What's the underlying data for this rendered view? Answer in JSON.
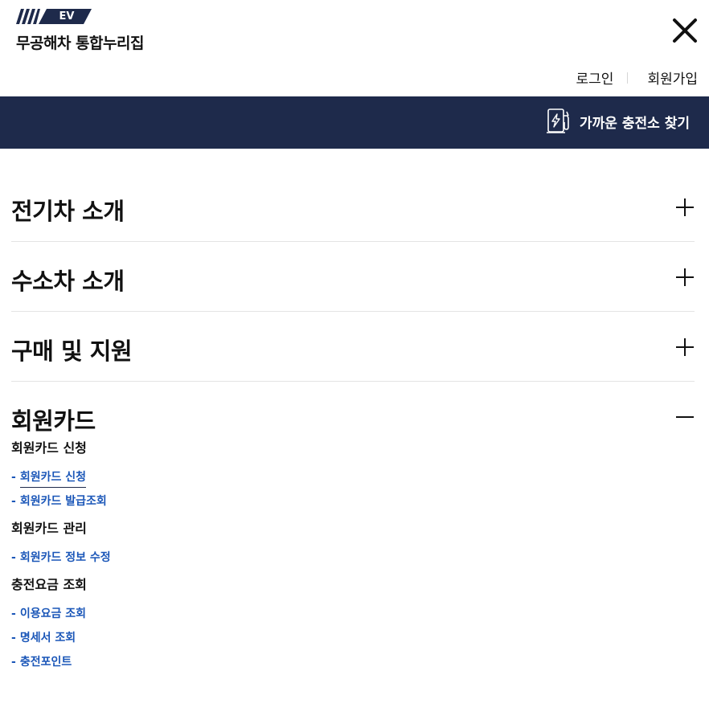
{
  "header": {
    "logo_badge": "EV",
    "logo_name": "무공해차 통합누리집",
    "login": "로그인",
    "signup": "회원가입"
  },
  "bar": {
    "find_label": "가까운 충전소 찾기"
  },
  "menu": {
    "items": [
      {
        "label": "전기차 소개"
      },
      {
        "label": "수소차 소개"
      },
      {
        "label": "구매 및 지원"
      },
      {
        "label": "회원카드"
      }
    ],
    "groups": [
      {
        "title": "회원카드 신청",
        "links": [
          "회원카드 신청",
          "회원카드 발급조회"
        ]
      },
      {
        "title": "회원카드 관리",
        "links": [
          "회원카드 정보 수정"
        ]
      },
      {
        "title": "충전요금 조회",
        "links": [
          "이용요금 조회",
          "명세서 조회",
          "충전포인트"
        ]
      }
    ]
  },
  "colors": {
    "navy": "#1e2a4b",
    "link_blue": "#1a56b8"
  }
}
